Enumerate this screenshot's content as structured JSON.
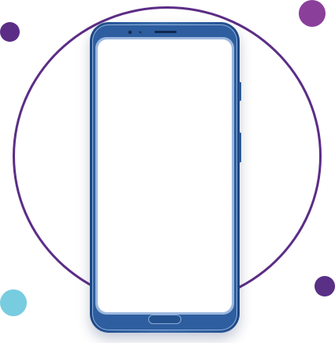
{
  "colors": {
    "ring": "#5c2d86",
    "dot_top_left": "#5c2d86",
    "dot_top_right": "#8a3f9a",
    "dot_bottom_right": "#5a2f86",
    "dot_bottom_left": "#78cce0",
    "phone_body": "#2b5a9b",
    "screen": "#ffffff"
  },
  "icons": {
    "phone": "smartphone-icon",
    "camera": "camera-icon",
    "home": "home-button-icon"
  }
}
